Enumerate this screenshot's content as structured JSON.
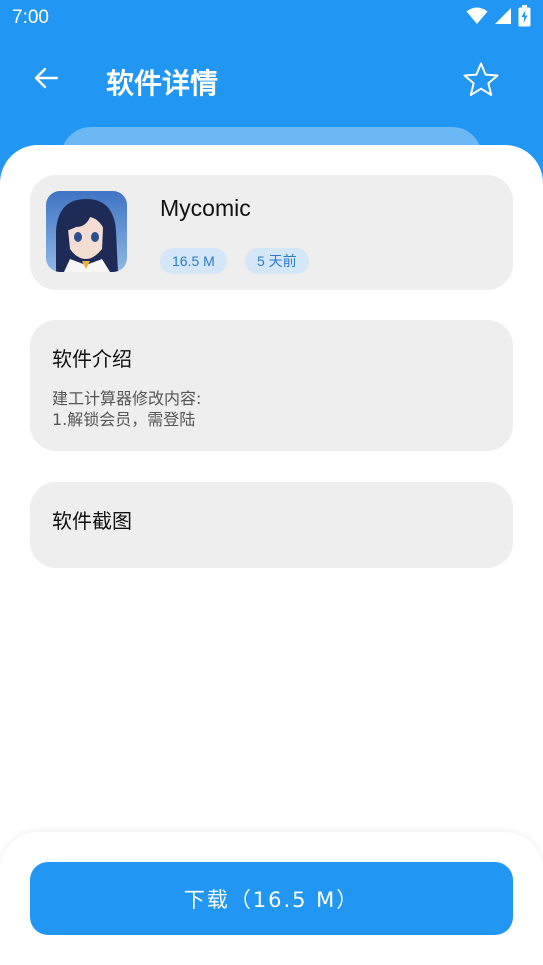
{
  "status_bar": {
    "time": "7:00",
    "icons": [
      "wifi-icon",
      "signal-icon",
      "battery-charging-icon"
    ]
  },
  "header": {
    "title": "软件详情",
    "back_icon": "arrow-left-icon",
    "favorite_icon": "star-outline-icon"
  },
  "app": {
    "name": "Mycomic",
    "size": "16.5 M",
    "updated": "5 天前",
    "icon": "anime-girl-app-icon"
  },
  "intro": {
    "title": "软件介绍",
    "text": "建工计算器修改内容:\n1.解锁会员，需登陆"
  },
  "screenshots": {
    "title": "软件截图"
  },
  "download": {
    "label": "下载（16.5 M）"
  },
  "colors": {
    "primary": "#2196F3",
    "card_bg": "#EEEEEE",
    "tag_bg": "#D4E6F7",
    "tag_text": "#2A7DCB"
  }
}
